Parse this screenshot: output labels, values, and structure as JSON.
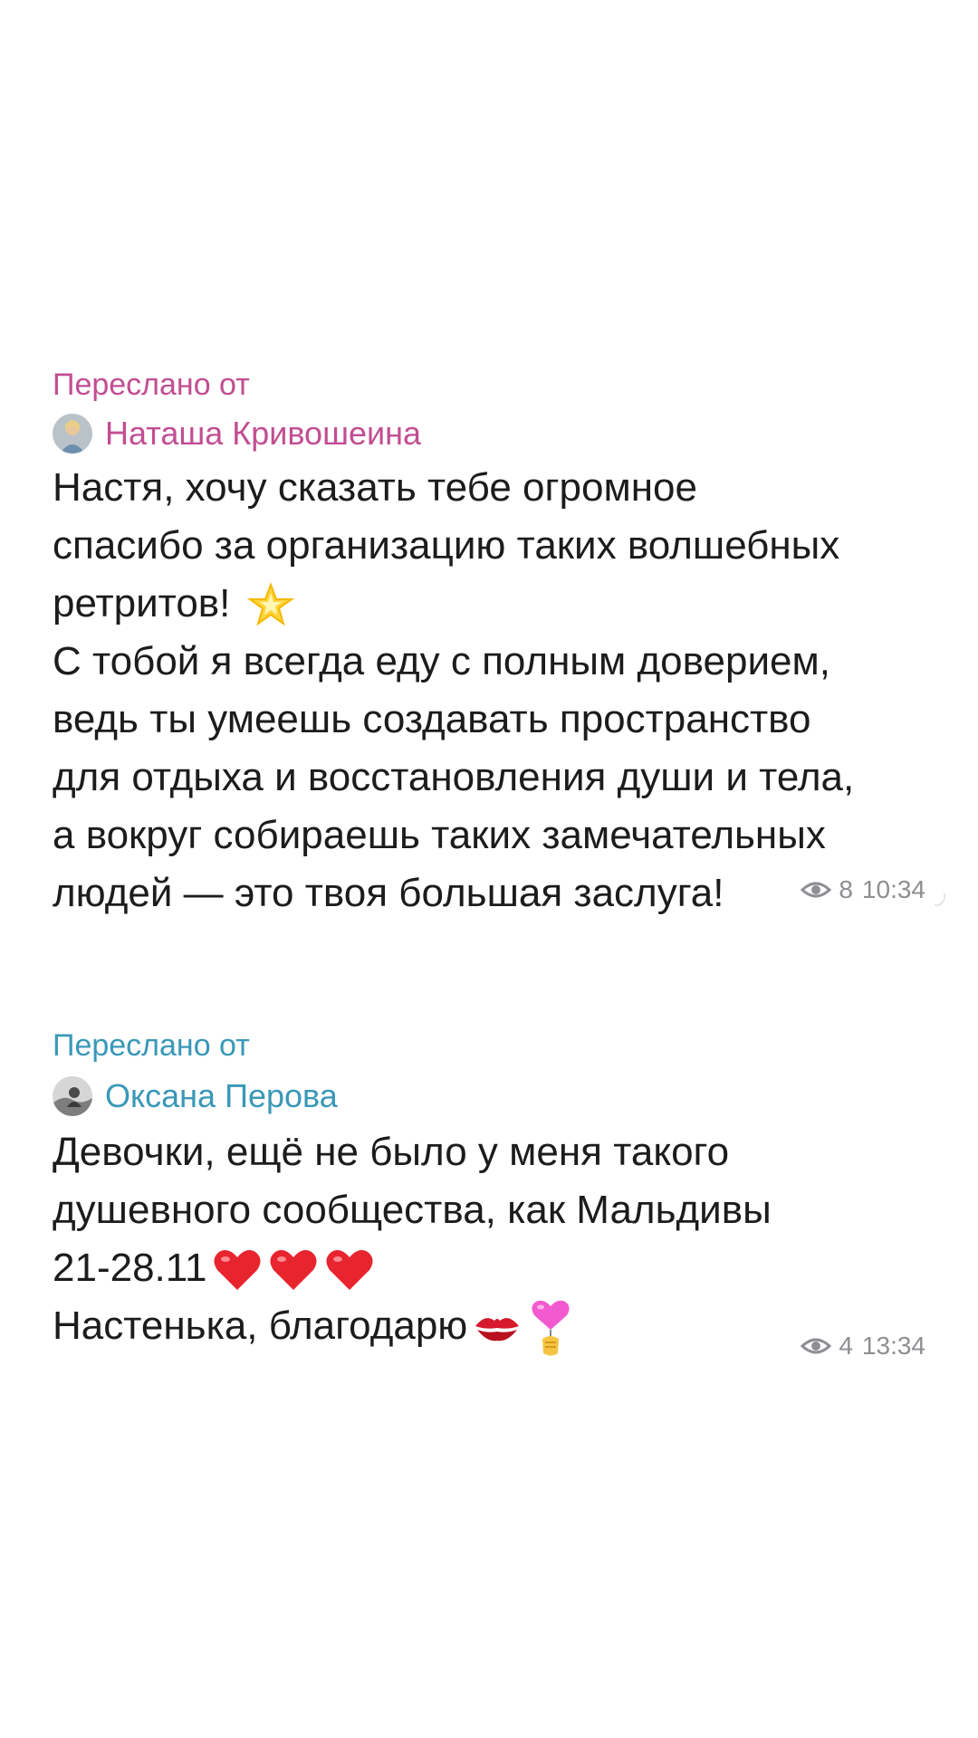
{
  "messages": [
    {
      "forwarded_label": "Переслано от",
      "sender_name": "Наташа Кривошеина",
      "sender_color": "#c24e92",
      "body_lines": [
        "Настя, хочу сказать тебе огромное",
        "спасибо за организацию таких волшебных",
        "ретритов! ",
        "С тобой я всегда еду с полным доверием,",
        "ведь ты умеешь создавать пространство",
        "для отдыха и восстановления души и тела,",
        "а вокруг собираешь таких замечательных",
        "людей — это твоя большая заслуга!"
      ],
      "emojis": [
        "glowing-star"
      ],
      "views": "8",
      "time": "10:34"
    },
    {
      "forwarded_label": "Переслано от",
      "sender_name": "Оксана Перова",
      "sender_color": "#3a98b8",
      "body_lines": [
        "Девочки,  ещё не было у меня такого",
        "душевного сообщества,  как Мальдивы",
        "21-28.11",
        "Настенька, благодарю"
      ],
      "emojis": [
        "red-heart",
        "red-heart",
        "red-heart",
        "kiss-mark",
        "heart-balloon"
      ],
      "views": "4",
      "time": "13:34"
    }
  ]
}
